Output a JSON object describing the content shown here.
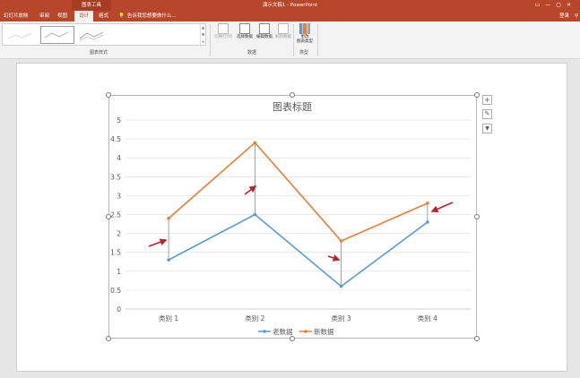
{
  "titlebar": {
    "context_tab": "图表工具",
    "window_title": "演示文稿1 - PowerPoint"
  },
  "tabs": [
    {
      "label": "幻灯片放映"
    },
    {
      "label": "审阅"
    },
    {
      "label": "视图"
    },
    {
      "label": "设计",
      "active": true
    },
    {
      "label": "格式"
    }
  ],
  "tell_me": "告诉我您想要做什么...",
  "login": "登录",
  "ribbon": {
    "groups": {
      "styles": "图表样式",
      "data": "数据",
      "type": "类型"
    },
    "buttons": {
      "switch_row_col": "切换行/列",
      "select_data": "选择数据",
      "edit_data": "编辑数据",
      "refresh_data": "刷新数据",
      "change_type_1": "更改",
      "change_type_2": "图表类型"
    }
  },
  "colors": {
    "old_series": "#5b9bd5",
    "new_series": "#ed7d31",
    "arrow": "#c0202d",
    "accent": "#b7472a"
  },
  "chart_data": {
    "type": "line",
    "title": "图表标题",
    "categories": [
      "类别 1",
      "类别 2",
      "类别 3",
      "类别 4"
    ],
    "series": [
      {
        "name": "老数据",
        "values": [
          1.3,
          2.5,
          0.6,
          2.3
        ],
        "color": "#5b9bd5"
      },
      {
        "name": "新数据",
        "values": [
          2.4,
          4.4,
          1.8,
          2.8
        ],
        "color": "#ed7d31"
      }
    ],
    "ylim": [
      0,
      5
    ],
    "yticks": [
      "0",
      "0.5",
      "1",
      "1.5",
      "2",
      "2.5",
      "3",
      "3.5",
      "4",
      "4.5",
      "5"
    ],
    "grid": true,
    "legend": "bottom",
    "drop_lines": true
  }
}
